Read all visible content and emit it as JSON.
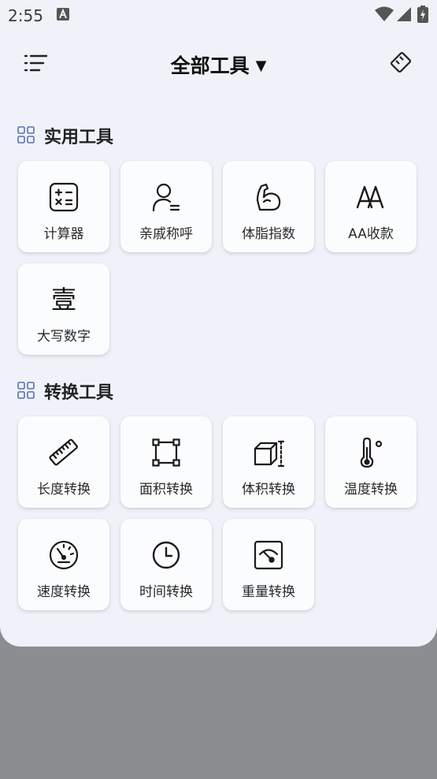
{
  "status_bar": {
    "time": "2:55"
  },
  "header": {
    "title": "全部工具",
    "caret": "▼"
  },
  "sections": [
    {
      "title": "实用工具",
      "tools": [
        {
          "label": "计算器",
          "icon": "calculator-icon"
        },
        {
          "label": "亲戚称呼",
          "icon": "person-icon"
        },
        {
          "label": "体脂指数",
          "icon": "muscle-arm-icon"
        },
        {
          "label": "AA收款",
          "icon": "aa-letters-icon"
        },
        {
          "label": "大写数字",
          "icon": "chinese-numeral-icon",
          "glyph": "壹"
        }
      ]
    },
    {
      "title": "转换工具",
      "tools": [
        {
          "label": "长度转换",
          "icon": "ruler-icon"
        },
        {
          "label": "面积转换",
          "icon": "area-square-icon"
        },
        {
          "label": "体积转换",
          "icon": "cube-icon"
        },
        {
          "label": "温度转换",
          "icon": "thermometer-icon"
        },
        {
          "label": "速度转换",
          "icon": "speedometer-icon"
        },
        {
          "label": "时间转换",
          "icon": "clock-icon"
        },
        {
          "label": "重量转换",
          "icon": "scale-gauge-icon"
        }
      ]
    }
  ],
  "colors": {
    "sheet": "#eff2f8",
    "scrim": "#8b8d91",
    "accent_grid": "#5a6fb0"
  }
}
